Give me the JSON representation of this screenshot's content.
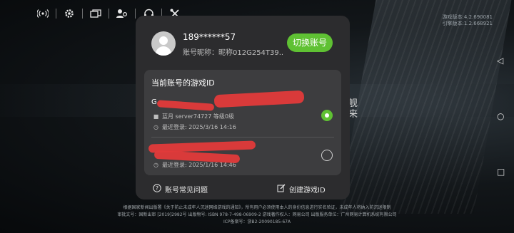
{
  "toolbar": {
    "icons": [
      "broadcast-icon",
      "gear-icon",
      "screens-icon",
      "location-user-icon",
      "headset-icon",
      "tools-icon"
    ]
  },
  "version": {
    "line1": "游戏版本:4.2.690081",
    "line2": "引擎版本:1.2.668921"
  },
  "background": {
    "side_text_1": "舰",
    "side_text_2": "来"
  },
  "account": {
    "phone": "189******57",
    "nickname": "账号昵称：昵称012G254T39...",
    "switch_label": "切换账号"
  },
  "game_ids": {
    "title": "当前账号的游戏ID",
    "items": [
      {
        "name": "G",
        "server_line": "蓝月  server74727  等级0级",
        "login_line": "最近登录: 2025/3/16 14:16",
        "selected": true
      },
      {
        "name": "",
        "server_line": "",
        "login_line": "最近登录: 2025/1/16 14:46",
        "selected": false
      }
    ]
  },
  "actions": {
    "faq_label": "账号常见问题",
    "create_label": "创建游戏ID"
  },
  "footer": {
    "line1": "根据国家新闻出版署《关于防止未成年人沉迷网络游戏的通知》，所有用户必须使用本人的身份信息进行实名验证，未成年人将纳入防沉迷限制",
    "line2": "审批文号：国新出审 [2019]2982号  出版物号: ISBN 978-7-498-06909-2  游戏著作权人：网易公司  出版服务单位：广州网易计算机系统有限公司",
    "line3": "ICP备案号：浙B2-20090185-67A"
  },
  "colors": {
    "accent": "#5fc133",
    "panel": "#2c2c2e",
    "card": "#3d3d3f",
    "redaction": "#e23a3a"
  }
}
